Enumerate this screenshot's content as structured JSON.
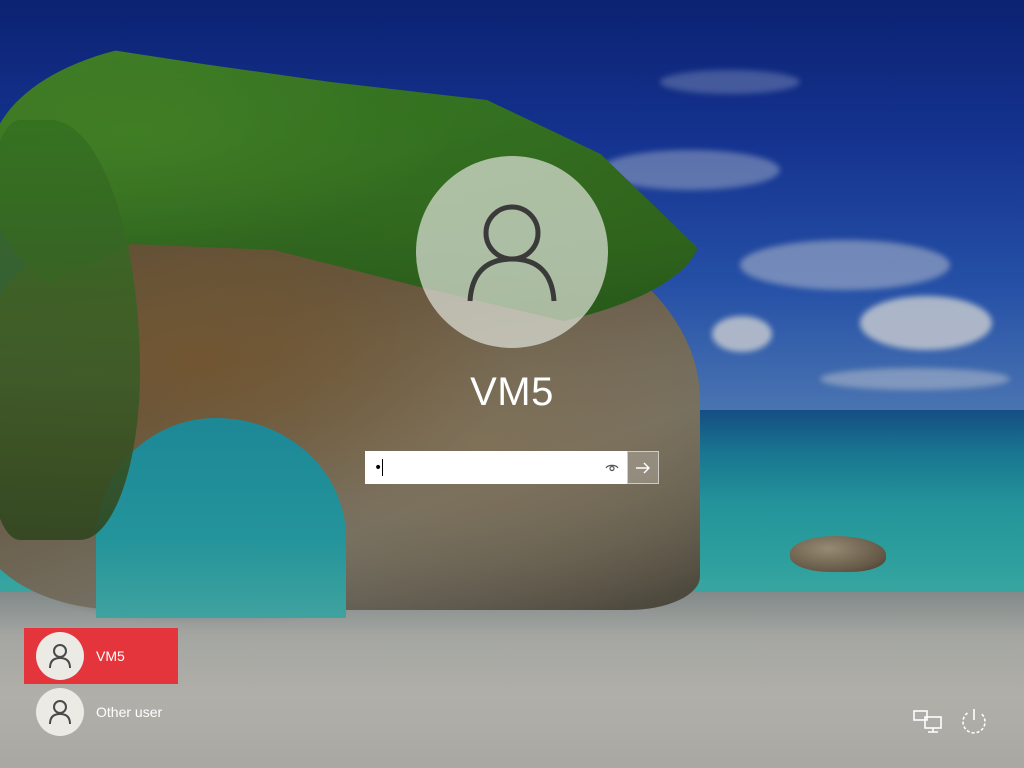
{
  "login": {
    "username": "VM5",
    "password_mask": "•",
    "icons": {
      "avatar": "user-silhouette-icon",
      "reveal": "eye-icon",
      "submit": "arrow-right-icon"
    }
  },
  "user_list": [
    {
      "label": "VM5",
      "selected": true,
      "icon": "user-silhouette-icon"
    },
    {
      "label": "Other user",
      "selected": false,
      "icon": "user-silhouette-icon"
    }
  ],
  "corner_icons": {
    "network": "network-icon",
    "power": "power-icon"
  },
  "colors": {
    "selected_tile": "#e4353d",
    "avatar_bg": "#eceae4",
    "text": "#ffffff"
  }
}
